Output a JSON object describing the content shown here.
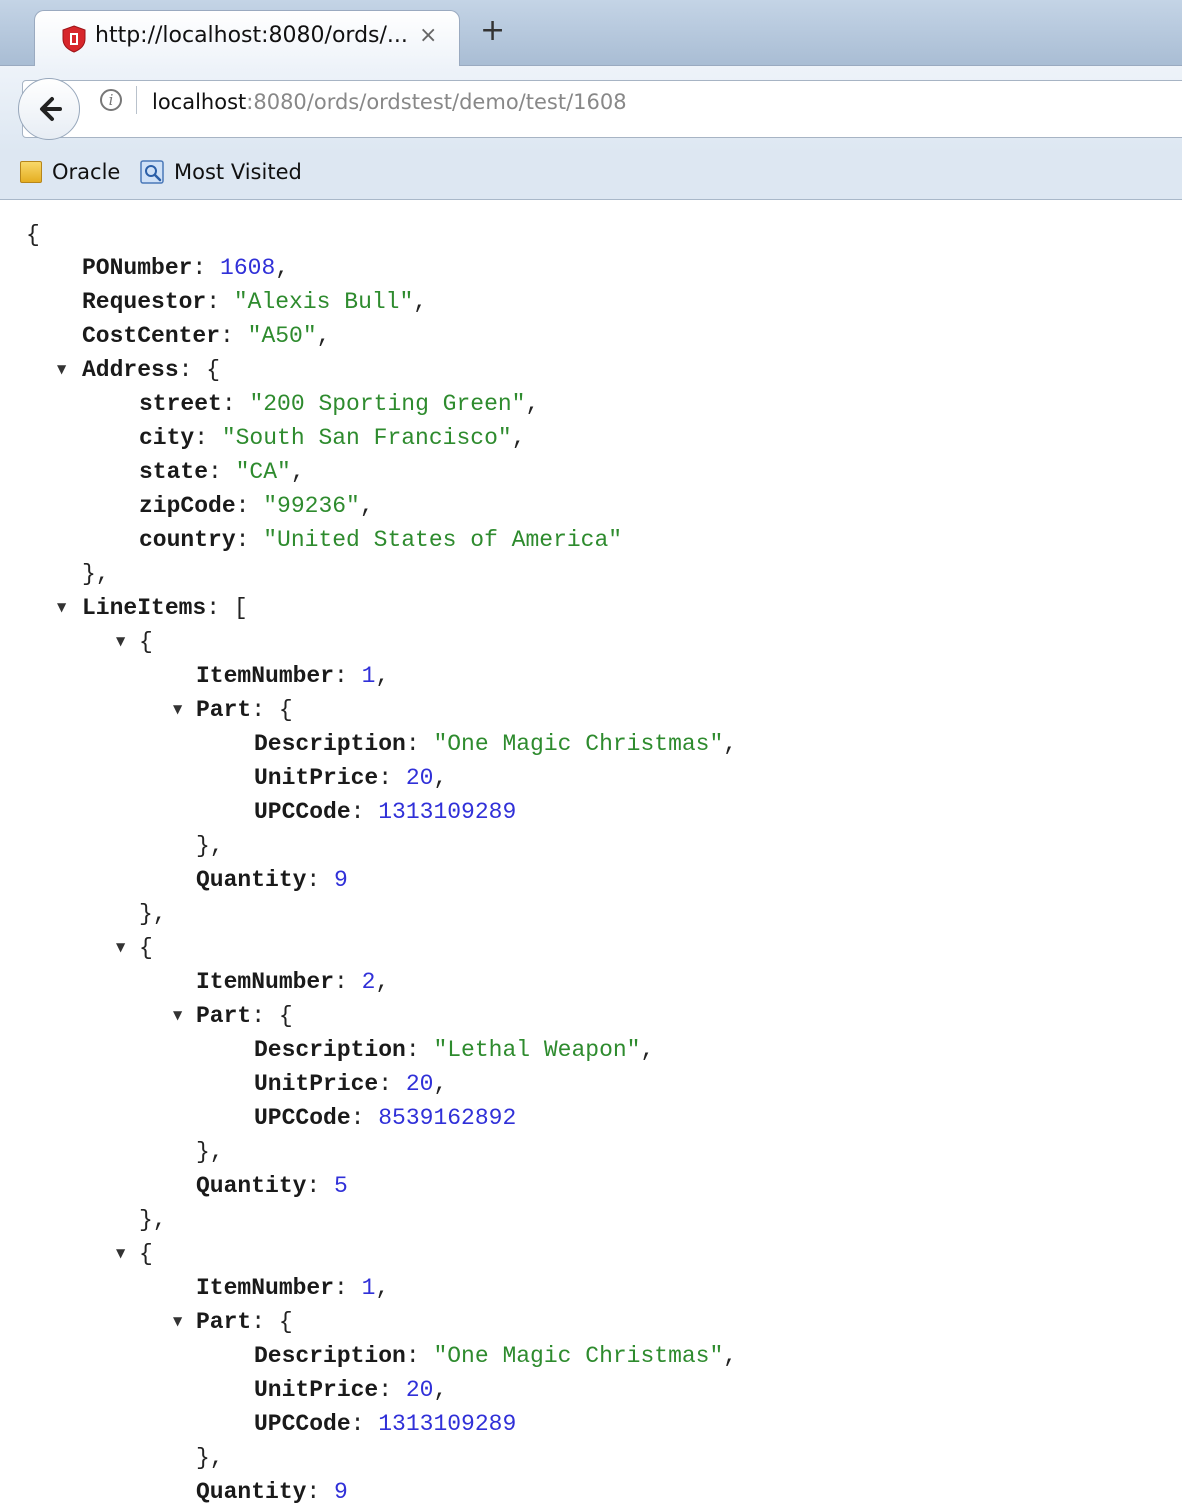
{
  "browser": {
    "tab_title": "http://localhost:8080/ords/...",
    "tab_close": "×",
    "new_tab": "+",
    "url_host": "localhost",
    "url_rest": ":8080/ords/ordstest/demo/test/1608",
    "info_glyph": "i",
    "bookmarks": [
      "Oracle",
      "Most Visited"
    ]
  },
  "json": {
    "PONumber": "1608",
    "Requestor": "\"Alexis Bull\"",
    "CostCenter": "\"A50\"",
    "Address": {
      "street": "\"200 Sporting Green\"",
      "city": "\"South San Francisco\"",
      "state": "\"CA\"",
      "zipCode": "\"99236\"",
      "country": "\"United States of America\""
    },
    "LineItems": [
      {
        "ItemNumber": "1",
        "Description": "\"One Magic Christmas\"",
        "UnitPrice": "20",
        "UPCCode": "1313109289",
        "Quantity": "9"
      },
      {
        "ItemNumber": "2",
        "Description": "\"Lethal Weapon\"",
        "UnitPrice": "20",
        "UPCCode": "8539162892",
        "Quantity": "5"
      },
      {
        "ItemNumber": "1",
        "Description": "\"One Magic Christmas\"",
        "UnitPrice": "20",
        "UPCCode": "1313109289",
        "Quantity": "9"
      }
    ]
  },
  "colors": {
    "string": "#2e8b2e",
    "number": "#3030d8",
    "key": "#1a1a1a"
  }
}
